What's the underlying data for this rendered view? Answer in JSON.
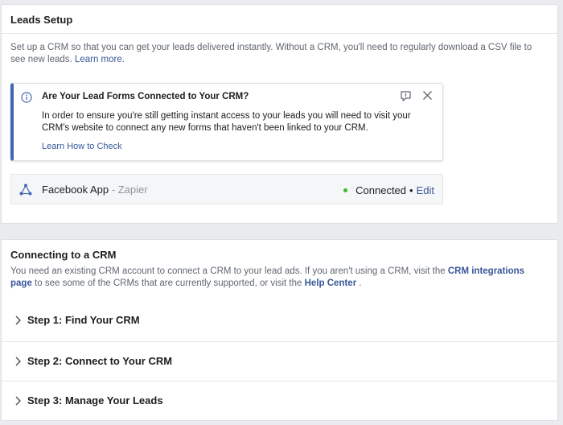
{
  "leads_setup": {
    "title": "Leads Setup",
    "description": "Set up a CRM so that you can get your leads delivered instantly. Without a CRM, you'll need to regularly download a CSV file to see new leads.",
    "learn_more": "Learn more.",
    "notice": {
      "title": "Are Your Lead Forms Connected to Your CRM?",
      "body": "In order to ensure you're still getting instant access to your leads you will need to visit your CRM's website to connect any new forms that haven't been linked to your CRM.",
      "link": "Learn How to Check",
      "accent_color": "#4267b2"
    },
    "app": {
      "name": "Facebook App",
      "provider": "- Zapier",
      "status": "Connected",
      "separator": "•",
      "edit": "Edit",
      "status_color": "#42b72a"
    }
  },
  "crm": {
    "title": "Connecting to a CRM",
    "desc_part1": "You need an existing CRM account to connect a CRM to your lead ads. If you aren't using a CRM, visit the",
    "integrations_link": "CRM integrations page",
    "desc_part2": "to see some of the CRMs that are currently supported, or visit the",
    "help_link": "Help Center",
    "desc_end": ".",
    "steps": [
      {
        "label": "Step 1: Find Your CRM"
      },
      {
        "label": "Step 2: Connect to Your CRM"
      },
      {
        "label": "Step 3: Manage Your Leads"
      }
    ]
  },
  "icons": {
    "info": "info-circle-icon",
    "feedback": "feedback-flag-icon",
    "close": "close-icon",
    "app": "zapier-app-icon",
    "chevron": "chevron-right-icon"
  }
}
